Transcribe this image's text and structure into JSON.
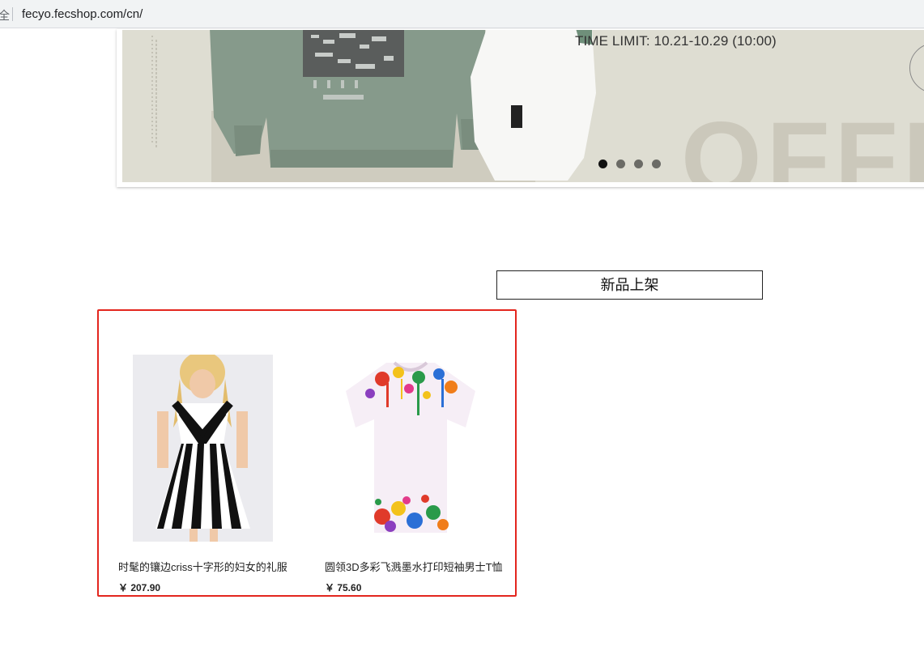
{
  "browser": {
    "security_label": "全",
    "url": "fecyo.fecshop.com/cn/"
  },
  "banner": {
    "time_limit": "TIME LIMIT: 10.21-10.29 (10:00)",
    "big_text": "OFFF",
    "slide_count": 4,
    "active_slide": 1
  },
  "section": {
    "title": "新品上架"
  },
  "products": [
    {
      "name": "时髦的镶边criss十字形的妇女的礼服",
      "price": "￥ 207.90",
      "image": "striped-dress"
    },
    {
      "name": "圆领3D多彩飞溅墨水打印短袖男士T恤",
      "price": "￥ 75.60",
      "image": "paint-splatter-tshirt"
    }
  ],
  "colors": {
    "highlight_border": "#e3261e",
    "banner_bg": "#deddd2"
  }
}
